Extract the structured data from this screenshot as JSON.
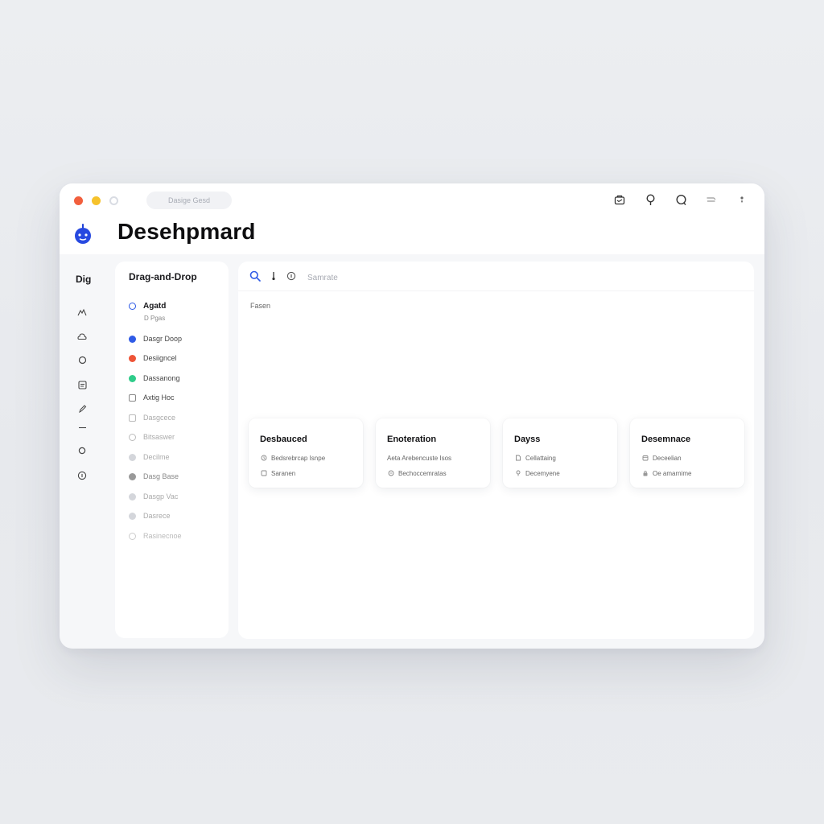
{
  "window": {
    "url": "Dasige Gesd",
    "title": "Desehpmard",
    "colors": {
      "red": "#f25f3d",
      "yellow": "#f6c22c",
      "accent": "#2f5be6"
    }
  },
  "rail": {
    "label": "Dig",
    "icons": [
      "people-icon",
      "cloud-icon",
      "circle-icon",
      "document-icon",
      "pen-icon",
      "minus-icon",
      "ring-icon",
      "info-icon"
    ]
  },
  "sidebar": {
    "title": "Drag-and-Drop",
    "items": [
      {
        "label": "Agatd",
        "bullet": "#2f5be6",
        "style": "ring"
      },
      {
        "label": "Dasgr Doop",
        "bullet": "#2f5be6",
        "style": "fill"
      },
      {
        "label": "Desiigncel",
        "bullet": "#ee5437",
        "style": "fill"
      },
      {
        "label": "Dassanong",
        "bullet": "#2fcc8a",
        "style": "fill"
      },
      {
        "label": "Axtig Hoc",
        "bullet": "#888",
        "style": "square"
      },
      {
        "label": "Dasgcece",
        "bullet": "#bbb",
        "style": "square"
      },
      {
        "label": "Bitsaswer",
        "bullet": "#bbb",
        "style": "ring"
      },
      {
        "label": "Decilme",
        "bullet": "#bbb",
        "style": "ring"
      },
      {
        "label": "Dasg Base",
        "bullet": "#999",
        "style": "fill"
      },
      {
        "label": "Dasgp Vac",
        "bullet": "#bbb",
        "style": "ring"
      },
      {
        "label": "Dasrece",
        "bullet": "#bbb",
        "style": "ring"
      },
      {
        "label": "Rasinecnoe",
        "bullet": "#ccc",
        "style": "ring"
      }
    ],
    "sub_label": "D Pgas"
  },
  "main": {
    "search_placeholder": "Samrate",
    "section_label": "Fasen",
    "cards": [
      {
        "title": "Desbauced",
        "rows": [
          "Bedsrebrcap Isnpe",
          "Saranen"
        ]
      },
      {
        "title": "Enoteration",
        "rows": [
          "Aeta Arebencuste Isos",
          "Bechoccemratas"
        ]
      },
      {
        "title": "Dayss",
        "rows": [
          "Cellattaing",
          "Decemyene"
        ]
      },
      {
        "title": "Desemnace",
        "rows": [
          "Deceelian",
          "Oe amarnime"
        ]
      }
    ]
  }
}
